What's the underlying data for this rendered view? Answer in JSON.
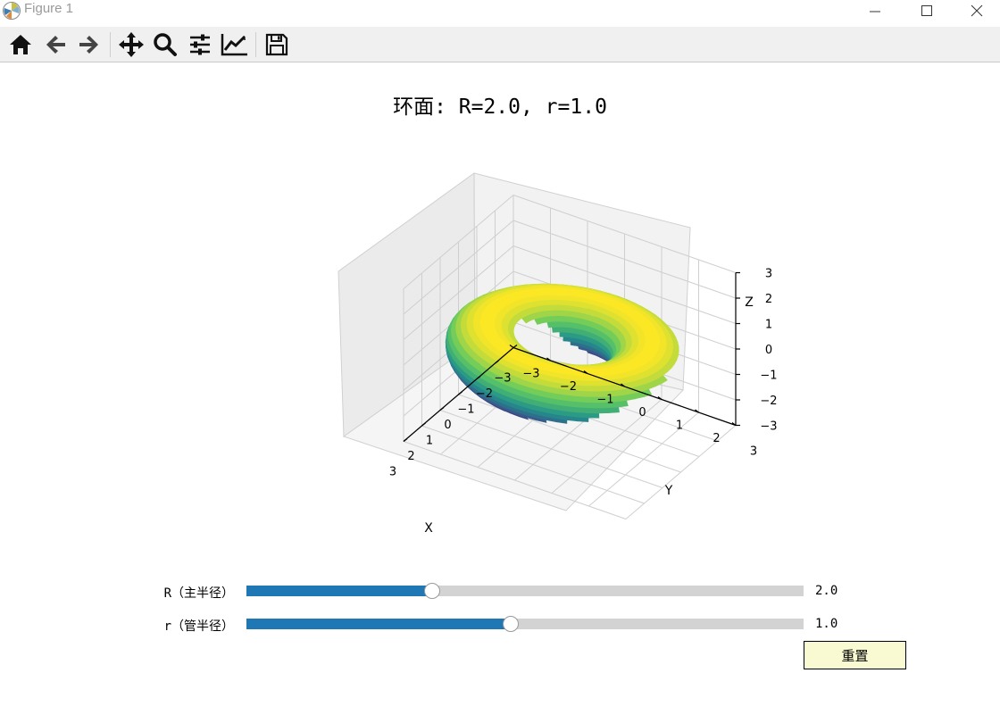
{
  "window": {
    "title": "Figure 1"
  },
  "toolbar": {
    "icons": [
      "home-icon",
      "back-arrow-icon",
      "forward-arrow-icon",
      "pan-icon",
      "zoom-icon",
      "subplots-icon",
      "edit-axes-icon",
      "save-icon"
    ]
  },
  "figure": {
    "title": "环面: R=2.0, r=1.0",
    "chart_data": {
      "type": "surface3d",
      "surface": "torus",
      "R": 2.0,
      "r": 1.0,
      "colormap": "viridis",
      "xlabel": "X",
      "ylabel": "Y",
      "zlabel": "Z",
      "xlim": [
        -3,
        3
      ],
      "ylim": [
        -3,
        3
      ],
      "zlim": [
        -3,
        3
      ],
      "xticks": [
        "−3",
        "−2",
        "−1",
        "0",
        "1",
        "2",
        "3"
      ],
      "yticks": [
        "−3",
        "−2",
        "−1",
        "0",
        "1",
        "2",
        "3"
      ],
      "zticks": [
        "−3",
        "−2",
        "−1",
        "0",
        "1",
        "2",
        "3"
      ],
      "grid": true
    }
  },
  "sliders": [
    {
      "label": "R（主半径）",
      "value_text": "2.0",
      "fraction": 0.333
    },
    {
      "label": "r（管半径）",
      "value_text": "1.0",
      "fraction": 0.474
    }
  ],
  "reset_button": {
    "label": "重置"
  },
  "colors": {
    "slider_fill": "#1f77b4",
    "slider_track": "#d3d3d3",
    "button_bg": "#fafad2"
  }
}
